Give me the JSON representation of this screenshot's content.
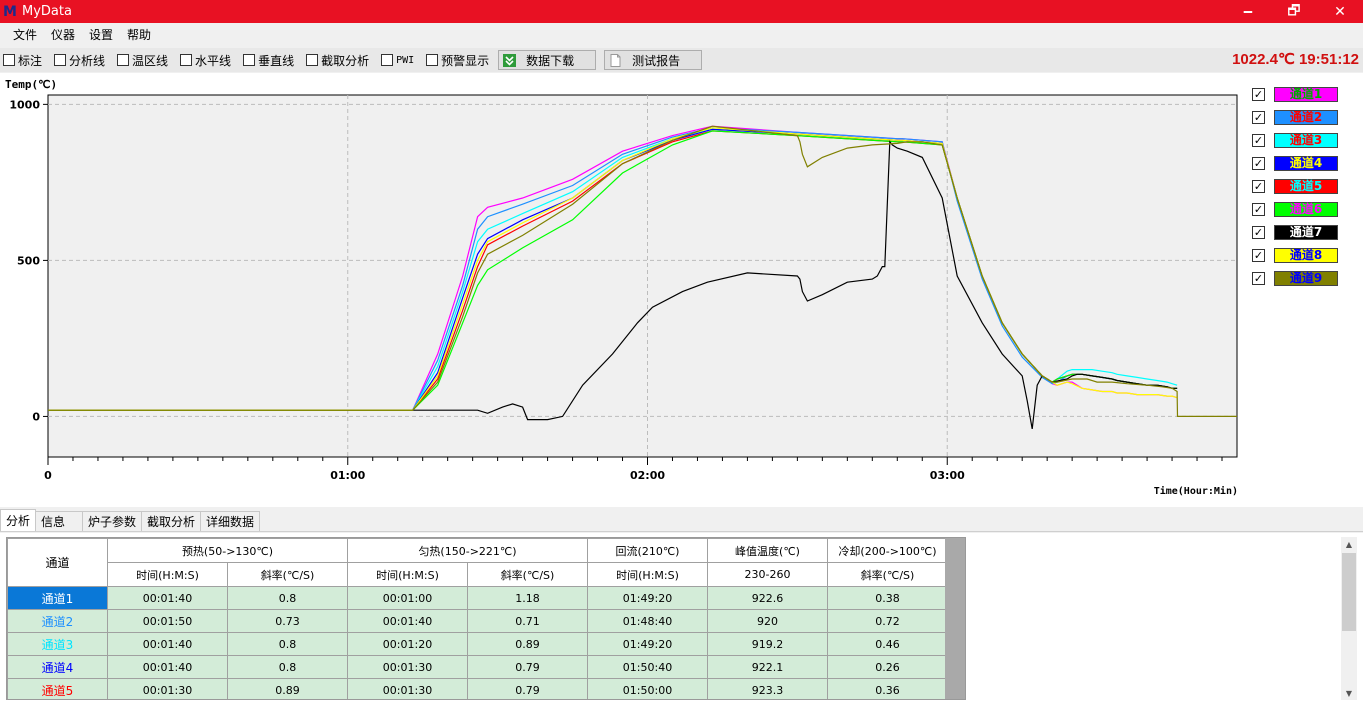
{
  "window": {
    "logo": "M",
    "title": "MyData",
    "minimize": "🗕",
    "restore": "🗗",
    "close": "✕"
  },
  "menu": [
    "文件",
    "仪器",
    "设置",
    "帮助"
  ],
  "toolbar": {
    "checks": [
      {
        "label": "标注",
        "checked": false
      },
      {
        "label": "分析线",
        "checked": false
      },
      {
        "label": "温区线",
        "checked": false
      },
      {
        "label": "水平线",
        "checked": false
      },
      {
        "label": "垂直线",
        "checked": false
      },
      {
        "label": "截取分析",
        "checked": false
      },
      {
        "label": "PWI",
        "checked": false
      },
      {
        "label": "预警显示",
        "checked": false
      }
    ],
    "download_label": "数据下载",
    "report_label": "测试报告",
    "status_readout": "1022.4℃ 19:51:12"
  },
  "legend": [
    {
      "label": "通道1",
      "bg": "#ff00ff",
      "fg": "#00aa00"
    },
    {
      "label": "通道2",
      "bg": "#1e90ff",
      "fg": "#ff0000"
    },
    {
      "label": "通道3",
      "bg": "#00ffff",
      "fg": "#ff0000"
    },
    {
      "label": "通道4",
      "bg": "#0000ff",
      "fg": "#ffff00"
    },
    {
      "label": "通道5",
      "bg": "#ff0000",
      "fg": "#00ffff"
    },
    {
      "label": "通道6",
      "bg": "#00ff00",
      "fg": "#ff00ff"
    },
    {
      "label": "通道7",
      "bg": "#000000",
      "fg": "#ffffff"
    },
    {
      "label": "通道8",
      "bg": "#ffff00",
      "fg": "#0000ff"
    },
    {
      "label": "通道9",
      "bg": "#808000",
      "fg": "#0000ff"
    }
  ],
  "chart_data": {
    "type": "line",
    "ylabel": "Temp(℃)",
    "xlabel": "Time(Hour:Min)",
    "ylim": [
      -130,
      1030
    ],
    "xlim": [
      0,
      238
    ],
    "y_ticks": [
      0,
      500,
      1000
    ],
    "x_ticks": [
      {
        "v": 0,
        "label": "0"
      },
      {
        "v": 60,
        "label": "01:00"
      },
      {
        "v": 120,
        "label": "02:00"
      },
      {
        "v": 180,
        "label": "03:00"
      }
    ],
    "grid": true,
    "series": [
      {
        "name": "通道1",
        "color": "#ff00ff",
        "x": [
          0,
          72,
          73,
          78,
          83,
          86,
          88,
          95,
          105,
          115,
          125,
          133,
          150,
          170,
          171,
          179,
          182,
          187,
          191,
          195,
          199,
          201,
          202,
          204,
          205,
          207,
          209,
          211,
          213,
          214,
          216,
          218,
          220,
          222,
          224,
          225,
          226
        ],
        "y": [
          20,
          20,
          20,
          200,
          450,
          640,
          670,
          700,
          760,
          850,
          900,
          930,
          910,
          890,
          890,
          880,
          700,
          450,
          300,
          200,
          130,
          105,
          100,
          110,
          110,
          90,
          85,
          80,
          80,
          75,
          75,
          70,
          70,
          70,
          65,
          65,
          60
        ]
      },
      {
        "name": "通道2",
        "color": "#1e90ff",
        "x": [
          0,
          72,
          73,
          78,
          83,
          86,
          88,
          95,
          105,
          115,
          125,
          133,
          150,
          170,
          171,
          179,
          182,
          187,
          191,
          195,
          199,
          201,
          202,
          204,
          205,
          207,
          209,
          211,
          213,
          214,
          216,
          218,
          220,
          222,
          224,
          225,
          226
        ],
        "y": [
          20,
          20,
          20,
          180,
          420,
          600,
          640,
          680,
          740,
          840,
          895,
          925,
          910,
          890,
          890,
          880,
          690,
          440,
          290,
          190,
          125,
          105,
          110,
          130,
          135,
          135,
          130,
          125,
          120,
          115,
          110,
          105,
          100,
          100,
          95,
          90,
          90
        ]
      },
      {
        "name": "通道3",
        "color": "#00ffff",
        "x": [
          0,
          72,
          73,
          78,
          83,
          86,
          88,
          95,
          105,
          115,
          125,
          133,
          150,
          170,
          171,
          179,
          182,
          187,
          191,
          195,
          199,
          201,
          202,
          204,
          205,
          207,
          209,
          211,
          213,
          214,
          216,
          218,
          220,
          222,
          224,
          225,
          226
        ],
        "y": [
          20,
          20,
          20,
          160,
          400,
          560,
          600,
          650,
          720,
          830,
          890,
          920,
          905,
          885,
          885,
          875,
          700,
          450,
          300,
          200,
          130,
          110,
          120,
          145,
          150,
          150,
          150,
          145,
          140,
          135,
          130,
          125,
          120,
          115,
          110,
          105,
          100
        ]
      },
      {
        "name": "通道4",
        "color": "#0000ff",
        "x": [
          0,
          72,
          73,
          78,
          83,
          86,
          88,
          95,
          105,
          115,
          125,
          133,
          150,
          170,
          171,
          179,
          182,
          187,
          191,
          195,
          199,
          201,
          202,
          204,
          205,
          207,
          209,
          211,
          213,
          214,
          216,
          218,
          220,
          222,
          224,
          225,
          226
        ],
        "y": [
          20,
          20,
          20,
          140,
          380,
          520,
          570,
          630,
          700,
          820,
          885,
          920,
          905,
          885,
          885,
          875,
          700,
          450,
          300,
          200,
          130,
          110,
          120,
          130,
          135,
          135,
          130,
          125,
          120,
          115,
          110,
          105,
          100,
          100,
          95,
          90,
          90
        ]
      },
      {
        "name": "通道5",
        "color": "#ff0000",
        "x": [
          0,
          72,
          73,
          78,
          83,
          86,
          88,
          95,
          105,
          115,
          125,
          133,
          150,
          170,
          171,
          179,
          182,
          187,
          191,
          195,
          199,
          201,
          202,
          204,
          205,
          207,
          209,
          211,
          213,
          214,
          216,
          218,
          220,
          222,
          224,
          225,
          226
        ],
        "y": [
          20,
          20,
          20,
          120,
          340,
          480,
          550,
          610,
          690,
          810,
          880,
          915,
          900,
          880,
          880,
          870,
          700,
          450,
          300,
          200,
          130,
          110,
          120,
          130,
          135,
          135,
          130,
          125,
          120,
          115,
          110,
          105,
          100,
          100,
          95,
          90,
          90
        ]
      },
      {
        "name": "通道6",
        "color": "#00ff00",
        "x": [
          0,
          72,
          73,
          78,
          83,
          86,
          88,
          95,
          105,
          115,
          125,
          133,
          150,
          170,
          171,
          179,
          182,
          187,
          191,
          195,
          199,
          201,
          202,
          204,
          205,
          207,
          209,
          211,
          213,
          214,
          216,
          218,
          220,
          222,
          224,
          225,
          226
        ],
        "y": [
          20,
          20,
          20,
          100,
          300,
          420,
          470,
          540,
          630,
          780,
          870,
          915,
          900,
          880,
          880,
          870,
          700,
          450,
          300,
          200,
          130,
          110,
          120,
          130,
          135,
          135,
          130,
          125,
          120,
          115,
          110,
          105,
          100,
          100,
          95,
          90,
          90
        ]
      },
      {
        "name": "通道7",
        "color": "#000000",
        "x": [
          0,
          72,
          82,
          86,
          88,
          91,
          93,
          95,
          96,
          100,
          103,
          107,
          113,
          118,
          121,
          127,
          132,
          140,
          150,
          150.5,
          151,
          152,
          155,
          160,
          165,
          166,
          167,
          167.5,
          168.5,
          169,
          170,
          172,
          175,
          179,
          182,
          187,
          191,
          195,
          196,
          197,
          198,
          199,
          200,
          201,
          204,
          205,
          206,
          207,
          209,
          211,
          213,
          214,
          216,
          218,
          220,
          222,
          224,
          225,
          226
        ],
        "y": [
          20,
          20,
          20,
          20,
          10,
          30,
          40,
          30,
          -10,
          -10,
          0,
          100,
          200,
          300,
          350,
          400,
          430,
          460,
          450,
          440,
          400,
          370,
          390,
          430,
          440,
          450,
          480,
          480,
          880,
          870,
          860,
          850,
          830,
          700,
          450,
          300,
          200,
          130,
          50,
          -40,
          100,
          130,
          120,
          110,
          120,
          130,
          135,
          135,
          130,
          125,
          120,
          115,
          110,
          105,
          100,
          100,
          95,
          90,
          90
        ]
      },
      {
        "name": "通道8",
        "color": "#ffff00",
        "x": [
          0,
          72,
          73,
          78,
          83,
          86,
          88,
          95,
          105,
          115,
          125,
          133,
          150,
          170,
          171,
          179,
          182,
          187,
          191,
          195,
          199,
          201,
          202,
          204,
          205,
          207,
          209,
          211,
          213,
          214,
          216,
          218,
          220,
          222,
          224,
          225,
          226
        ],
        "y": [
          20,
          20,
          20,
          130,
          360,
          500,
          560,
          620,
          700,
          820,
          890,
          925,
          905,
          885,
          885,
          875,
          700,
          450,
          300,
          200,
          130,
          110,
          100,
          110,
          105,
          90,
          85,
          80,
          80,
          75,
          75,
          70,
          70,
          70,
          65,
          65,
          60
        ]
      },
      {
        "name": "通道9",
        "color": "#808000",
        "x": [
          0,
          72,
          73,
          78,
          83,
          86,
          88,
          95,
          105,
          115,
          125,
          133,
          150,
          150.5,
          151,
          152,
          155,
          160,
          165,
          170,
          172,
          175,
          179,
          182,
          187,
          191,
          195,
          199,
          200,
          201,
          202,
          205,
          208,
          210,
          213,
          216,
          220,
          223,
          225,
          226,
          226.1,
          227,
          232,
          238
        ],
        "y": [
          20,
          20,
          20,
          110,
          320,
          460,
          520,
          580,
          680,
          810,
          885,
          930,
          900,
          880,
          840,
          800,
          830,
          860,
          870,
          875,
          880,
          880,
          870,
          700,
          450,
          300,
          200,
          130,
          120,
          110,
          110,
          120,
          120,
          110,
          110,
          105,
          100,
          95,
          90,
          80,
          0,
          0,
          0,
          0
        ]
      }
    ]
  },
  "tabs": [
    {
      "label": "分析",
      "active": true
    },
    {
      "label": "信息",
      "active": false
    },
    {
      "label": "炉子参数",
      "active": false
    },
    {
      "label": "截取分析",
      "active": false
    },
    {
      "label": "详细数据",
      "active": false
    }
  ],
  "table": {
    "channel_header": "通道",
    "groups": [
      {
        "label": "预热(50->130℃)",
        "span": 2
      },
      {
        "label": "匀热(150->221℃)",
        "span": 2
      },
      {
        "label": "回流(210℃)",
        "span": 1
      },
      {
        "label": "峰值温度(℃)",
        "span": 1
      },
      {
        "label": "冷却(200->100℃)",
        "span": 1
      }
    ],
    "sub_headers": [
      "时间(H:M:S)",
      "斜率(℃/S)",
      "时间(H:M:S)",
      "斜率(℃/S)",
      "时间(H:M:S)",
      "230-260",
      "斜率(℃/S)"
    ],
    "rows": [
      {
        "channel": "通道1",
        "color": "#ffffff",
        "values": [
          "00:01:40",
          "0.8",
          "00:01:00",
          "1.18",
          "01:49:20",
          "922.6",
          "0.38"
        ]
      },
      {
        "channel": "通道2",
        "color": "#1e90ff",
        "values": [
          "00:01:50",
          "0.73",
          "00:01:40",
          "0.71",
          "01:48:40",
          "920",
          "0.72"
        ]
      },
      {
        "channel": "通道3",
        "color": "#00e5ff",
        "values": [
          "00:01:40",
          "0.8",
          "00:01:20",
          "0.89",
          "01:49:20",
          "919.2",
          "0.46"
        ]
      },
      {
        "channel": "通道4",
        "color": "#0000ff",
        "values": [
          "00:01:40",
          "0.8",
          "00:01:30",
          "0.79",
          "01:50:40",
          "922.1",
          "0.26"
        ]
      },
      {
        "channel": "通道5",
        "color": "#ff0000",
        "values": [
          "00:01:30",
          "0.89",
          "00:01:30",
          "0.79",
          "01:50:00",
          "923.3",
          "0.36"
        ]
      }
    ]
  },
  "scrollbar": {
    "up": "▲",
    "down": "▼"
  }
}
